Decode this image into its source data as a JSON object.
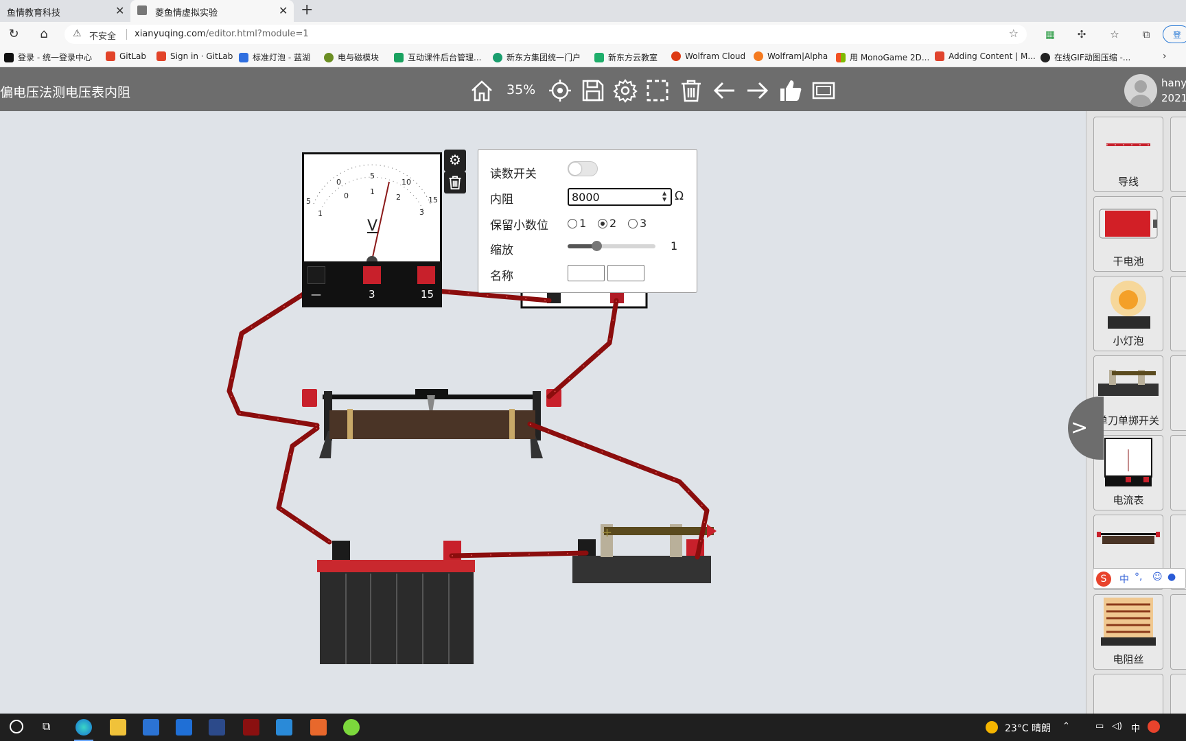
{
  "browser": {
    "tabs": [
      {
        "label": "鱼情教育科技"
      },
      {
        "label": "菱鱼情虚拟实验"
      }
    ],
    "new_tab": "+",
    "insecure_label": "不安全",
    "url_host": "xianyuqing.com",
    "url_path": "/editor.html?module=1",
    "login_label": "登",
    "bookmarks": [
      "登录 - 统一登录中心",
      "GitLab",
      "Sign in · GitLab",
      "标准灯泡 - 蓝湖",
      "电与磁模块",
      "互动课件后台管理...",
      "新东方集团统一门户",
      "新东方云教室",
      "Wolfram Cloud",
      "Wolfram|Alpha",
      "用 MonoGame 2D...",
      "Adding Content | M...",
      "在线GIF动图压缩 -..."
    ]
  },
  "app": {
    "title": "偏电压法测电压表内阻",
    "zoom": "35%",
    "toolbar_icons": [
      "home-icon",
      "locate-icon",
      "save-icon",
      "settings-icon",
      "select-icon",
      "delete-icon",
      "undo-icon",
      "redo-icon",
      "like-icon",
      "fullscreen-icon"
    ],
    "user_name": "hany",
    "user_date": "2021"
  },
  "meter": {
    "symbol": "V",
    "terminals": [
      "—",
      "3",
      "15"
    ],
    "scale_top": [
      "5",
      "0",
      "5",
      "10",
      "15"
    ],
    "scale_bottom": [
      "1",
      "0",
      "1",
      "2",
      "3"
    ]
  },
  "properties": {
    "reading_switch_label": "读数开关",
    "reading_switch_on": false,
    "resistance_label": "内阻",
    "resistance_value": "8000",
    "resistance_unit": "Ω",
    "decimals_label": "保留小数位",
    "decimal_options": [
      "1",
      "2",
      "3"
    ],
    "decimal_selected": "2",
    "scale_label": "缩放",
    "scale_value": "1",
    "scale_fraction": 0.33,
    "name_label": "名称"
  },
  "components": [
    {
      "label": "导线"
    },
    {
      "label": "干电池"
    },
    {
      "label": "小灯泡"
    },
    {
      "label": "单刀单掷开关"
    },
    {
      "label": "电流表"
    },
    {
      "label": ""
    },
    {
      "label": "电阻丝"
    }
  ],
  "taskbar": {
    "weather": "23°C 晴朗",
    "ime": "中"
  },
  "colors": {
    "header_bg": "#6d6d6d",
    "wire": "#8b0d0d",
    "terminal_red": "#c8202b"
  }
}
